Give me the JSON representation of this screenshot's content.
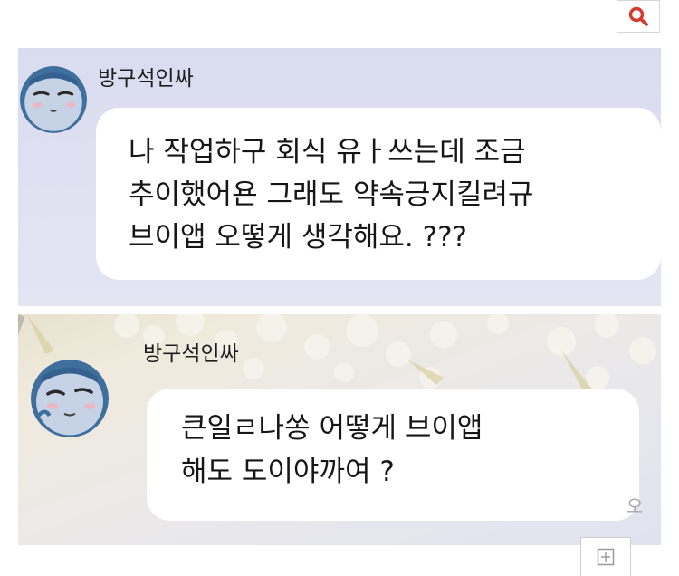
{
  "toolbar": {
    "search_icon": "search-icon",
    "search_color": "#d63a2b"
  },
  "messages": [
    {
      "sender": "방구석인싸",
      "lines": [
        "나 작업하구 회식 유ㅏ쓰는데 조금",
        "추이했어욘 그래도 약속긍지킬려규",
        "브이앱 오떻게 생각해요.   ???"
      ]
    },
    {
      "sender": "방구석인싸",
      "lines": [
        "큰일ㄹ나쏭 어떻게 브이앱",
        "해도 도이야까여 ?"
      ],
      "side_mark": "오"
    }
  ],
  "footer": {
    "expand_icon": "plus-square-icon"
  }
}
